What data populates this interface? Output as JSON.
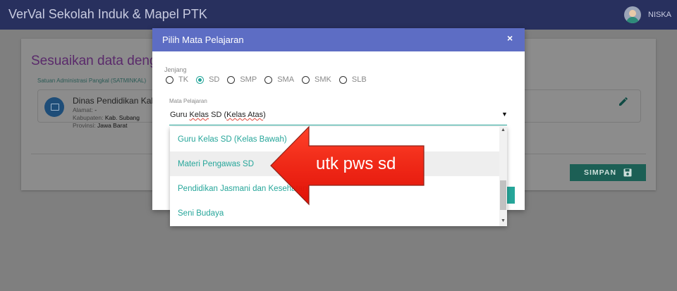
{
  "app": {
    "title": "VerVal Sekolah Induk & Mapel PTK",
    "user": "NISKA"
  },
  "background_card": {
    "title": "Sesuaikan data dengan",
    "satminkal_label": "Satuan Administrasi Pangkal (SATMINKAL)",
    "school_name": "Dinas Pendidikan Kab.",
    "alamat_label": "Alamat:",
    "alamat_value": "-",
    "kabupaten_label": "Kabupaten:",
    "kabupaten_value": "Kab. Subang",
    "provinsi_label": "Provinsi:",
    "provinsi_value": "Jawa Barat",
    "save_label": "SIMPAN"
  },
  "modal": {
    "title": "Pilih Mata Pelajaran",
    "close": "×",
    "jenjang_label": "Jenjang",
    "jenjang_options": [
      {
        "label": "TK",
        "selected": false
      },
      {
        "label": "SD",
        "selected": true
      },
      {
        "label": "SMP",
        "selected": false
      },
      {
        "label": "SMA",
        "selected": false
      },
      {
        "label": "SMK",
        "selected": false
      },
      {
        "label": "SLB",
        "selected": false
      }
    ],
    "mapel_label": "Mata Pelajaran",
    "mapel_value_pre": "Guru ",
    "mapel_value_sq1": "Kelas",
    "mapel_value_mid": " SD (",
    "mapel_value_sq2": "Kelas Atas",
    "mapel_value_post": ")",
    "mapel_arrow": "▼"
  },
  "dropdown": {
    "items": [
      {
        "label": "Guru Kelas SD (Kelas Bawah)",
        "highlighted": false
      },
      {
        "label": "Materi Pengawas SD",
        "highlighted": true
      },
      {
        "label": "Pendidikan Jasmani dan Kesehatan",
        "highlighted": false
      },
      {
        "label": "Seni Budaya",
        "highlighted": false
      }
    ],
    "scroll_up": "▲",
    "scroll_down": "▼"
  },
  "annotation": {
    "text": "utk pws sd",
    "color": "#ff1a0a"
  },
  "colors": {
    "topbar": "#28305e",
    "modal_header": "#5d6dc4",
    "teal": "#26a69a",
    "arrow": "#ff1a0a"
  }
}
